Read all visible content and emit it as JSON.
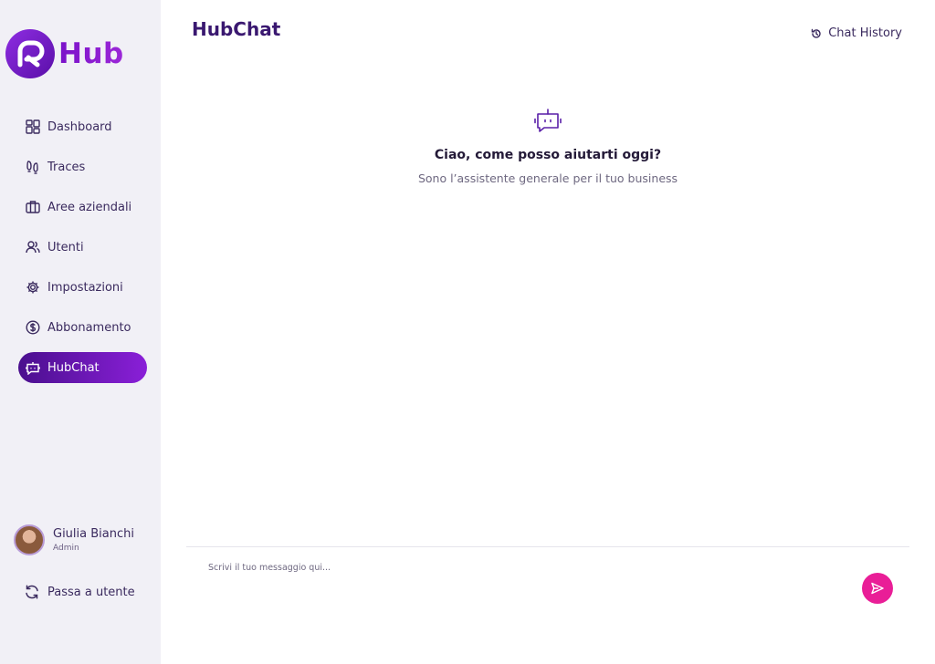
{
  "brand": {
    "name": "Hub"
  },
  "sidebar": {
    "items": [
      {
        "label": "Dashboard",
        "icon": "dashboard-icon",
        "active": false
      },
      {
        "label": "Traces",
        "icon": "footprints-icon",
        "active": false
      },
      {
        "label": "Aree aziendali",
        "icon": "briefcase-icon",
        "active": false
      },
      {
        "label": "Utenti",
        "icon": "users-icon",
        "active": false
      },
      {
        "label": "Impostazioni",
        "icon": "gear-icon",
        "active": false
      },
      {
        "label": "Abbonamento",
        "icon": "dollar-circle-icon",
        "active": false
      },
      {
        "label": "HubChat",
        "icon": "chatbot-icon",
        "active": true
      }
    ],
    "user": {
      "name": "Giulia Bianchi",
      "role": "Admin"
    },
    "switch_label": "Passa a utente"
  },
  "header": {
    "title": "HubChat",
    "history_label": "Chat History"
  },
  "welcome": {
    "title": "Ciao, come posso aiutarti oggi?",
    "subtitle": "Sono l’assistente generale per il tuo business"
  },
  "composer": {
    "placeholder": "Scrivi il tuo messaggio qui..."
  },
  "colors": {
    "accent": "#8a1fd8",
    "send": "#e91e97",
    "sidebar_bg": "#f1f0f6"
  }
}
